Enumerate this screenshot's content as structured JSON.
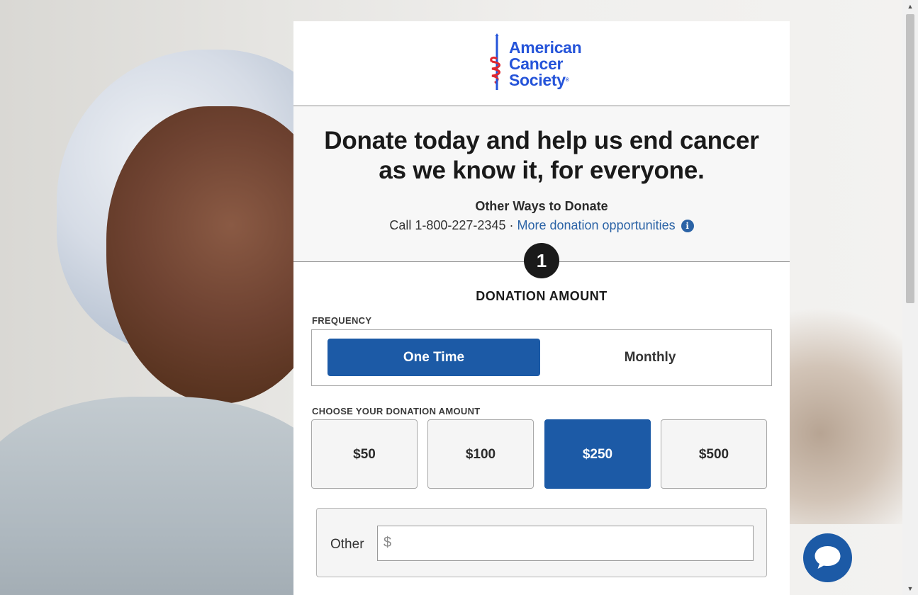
{
  "brand": {
    "line1": "American",
    "line2": "Cancer",
    "line3": "Society",
    "registered": "®",
    "color": "#2554d9",
    "accent": "#e0262f"
  },
  "hero": {
    "headline_line1": "Donate today and help us end cancer",
    "headline_line2": "as we know it, for everyone.",
    "other_ways_title": "Other Ways to Donate",
    "call_text": "Call 1-800-227-2345 · ",
    "more_link": "More donation opportunities",
    "info_icon": "i"
  },
  "step": {
    "number": "1",
    "title": "DONATION AMOUNT"
  },
  "frequency": {
    "label": "FREQUENCY",
    "options": [
      "One Time",
      "Monthly"
    ],
    "selected": "One Time"
  },
  "amount": {
    "label": "CHOOSE YOUR DONATION AMOUNT",
    "options": [
      "$50",
      "$100",
      "$250",
      "$500"
    ],
    "selected": "$250",
    "other_label": "Other",
    "currency_symbol": "$",
    "other_value": ""
  },
  "colors": {
    "primary": "#1c5aa6",
    "link": "#2b63a6"
  },
  "chat": {
    "icon": "chat-bubble-icon"
  }
}
